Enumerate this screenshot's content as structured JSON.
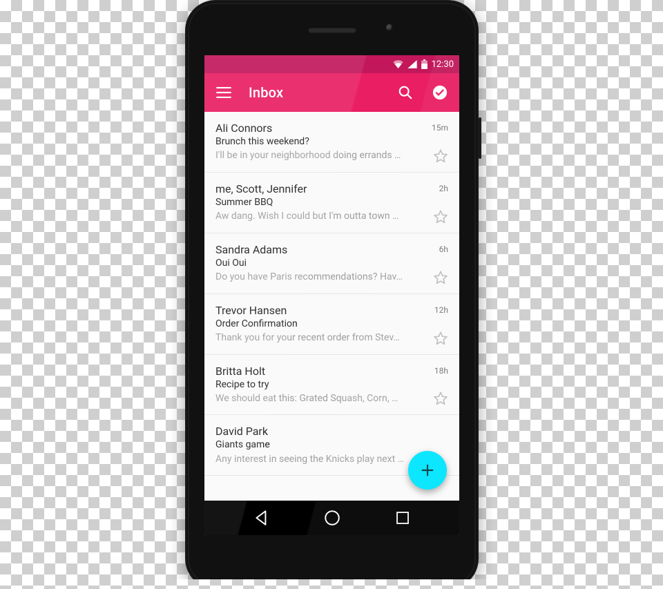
{
  "statusbar": {
    "time": "12:30"
  },
  "appbar": {
    "title": "Inbox"
  },
  "emails": [
    {
      "sender": "Ali Connors",
      "time": "15m",
      "subject": "Brunch this weekend?",
      "preview": "I'll be in your neighborhood doing errands …"
    },
    {
      "sender": "me, Scott, Jennifer",
      "time": "2h",
      "subject": "Summer BBQ",
      "preview": "Aw dang. Wish I could but I'm outta town …"
    },
    {
      "sender": "Sandra Adams",
      "time": "6h",
      "subject": "Oui Oui",
      "preview": "Do you have Paris recommendations? Hav…"
    },
    {
      "sender": "Trevor Hansen",
      "time": "12h",
      "subject": "Order Confirmation",
      "preview": "Thank you for your recent order from Stev…"
    },
    {
      "sender": "Britta Holt",
      "time": "18h",
      "subject": "Recipe to try",
      "preview": "We should eat this: Grated Squash, Corn, …"
    },
    {
      "sender": "David Park",
      "time": "",
      "subject": "Giants game",
      "preview": "Any interest in seeing the Knicks play next …"
    }
  ],
  "colors": {
    "primary": "#e91e63",
    "primaryDark": "#c2185b",
    "accent": "#00e5ff"
  }
}
